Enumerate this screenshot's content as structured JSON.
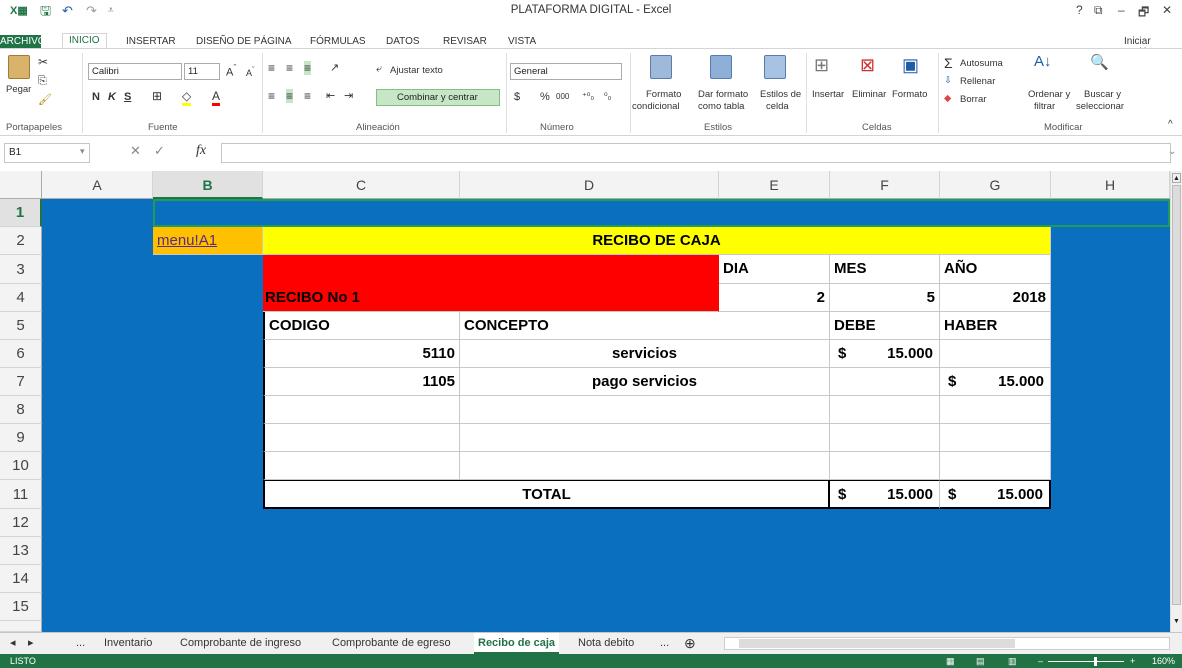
{
  "window": {
    "title": "PLATAFORMA DIGITAL - Excel",
    "help": "?",
    "restore": "⧉",
    "minimize": "–",
    "maximize": "🗗",
    "close": "✕"
  },
  "tabs": {
    "file": "ARCHIVO",
    "home": "INICIO",
    "insert": "INSERTAR",
    "layout": "DISEÑO DE PÁGINA",
    "formulas": "FÓRMULAS",
    "data": "DATOS",
    "review": "REVISAR",
    "view": "VISTA",
    "signin": "Iniciar sesión"
  },
  "ribbon": {
    "paste": "Pegar",
    "clipboard_group": "Portapapeles",
    "font_name": "Calibri",
    "font_size": "11",
    "bold": "N",
    "italic": "K",
    "underline": "S",
    "font_group": "Fuente",
    "wrap_text": "Ajustar texto",
    "merge_center": "Combinar y centrar",
    "alignment_group": "Alineación",
    "number_format": "General",
    "currency": "$",
    "percent": "%",
    "thousands": "000",
    "inc_decimal": "⁺⁰₀",
    "dec_decimal": "⁰₀",
    "number_group": "Número",
    "cond_format_1": "Formato",
    "cond_format_2": "condicional",
    "table_format_1": "Dar formato",
    "table_format_2": "como tabla",
    "cell_styles_1": "Estilos de",
    "cell_styles_2": "celda",
    "styles_group": "Estilos",
    "insert": "Insertar",
    "delete": "Eliminar",
    "format": "Formato",
    "cells_group": "Celdas",
    "autosum": "Autosuma",
    "fill": "Rellenar",
    "clear": "Borrar",
    "sort_1": "Ordenar y",
    "sort_2": "filtrar",
    "find_1": "Buscar y",
    "find_2": "seleccionar",
    "edit_group": "Modificar"
  },
  "formula_bar": {
    "name_box": "B1",
    "fx": "fx",
    "value": ""
  },
  "columns": [
    "A",
    "B",
    "C",
    "D",
    "E",
    "F",
    "G",
    "H"
  ],
  "rows": [
    "1",
    "2",
    "3",
    "4",
    "5",
    "6",
    "7",
    "8",
    "9",
    "10",
    "11",
    "12",
    "13",
    "14",
    "15"
  ],
  "sheet": {
    "link": "menu!A1",
    "title": "RECIBO DE CAJA",
    "dia_label": "DIA",
    "mes_label": "MES",
    "anio_label": "AÑO",
    "recibo": "RECIBO No 1",
    "dia": "2",
    "mes": "5",
    "anio": "2018",
    "h_codigo": "CODIGO",
    "h_concepto": "CONCEPTO",
    "h_debe": "DEBE",
    "h_haber": "HABER",
    "r6_codigo": "5110",
    "r6_concepto": "servicios",
    "r6_debe_cur": "$",
    "r6_debe": "15.000",
    "r7_codigo": "1105",
    "r7_concepto": "pago servicios",
    "r7_haber_cur": "$",
    "r7_haber": "15.000",
    "total_label": "TOTAL",
    "total_debe_cur": "$",
    "total_debe": "15.000",
    "total_haber_cur": "$",
    "total_haber": "15.000"
  },
  "sheet_tabs": {
    "ellipsis_left": "...",
    "t1": "Inventario",
    "t2": "Comprobante de ingreso",
    "t3": "Comprobante de egreso",
    "t4": "Recibo de caja",
    "t5": "Nota debito",
    "ellipsis_right": "...",
    "add": "⊕"
  },
  "status": {
    "ready": "LISTO",
    "zoom": "160%"
  },
  "colors": {
    "excel_green": "#217346",
    "sheet_blue": "#0b6fc0",
    "title_yellow": "#ffff00",
    "link_orange": "#ffc000",
    "recibo_red": "#ff0000"
  }
}
